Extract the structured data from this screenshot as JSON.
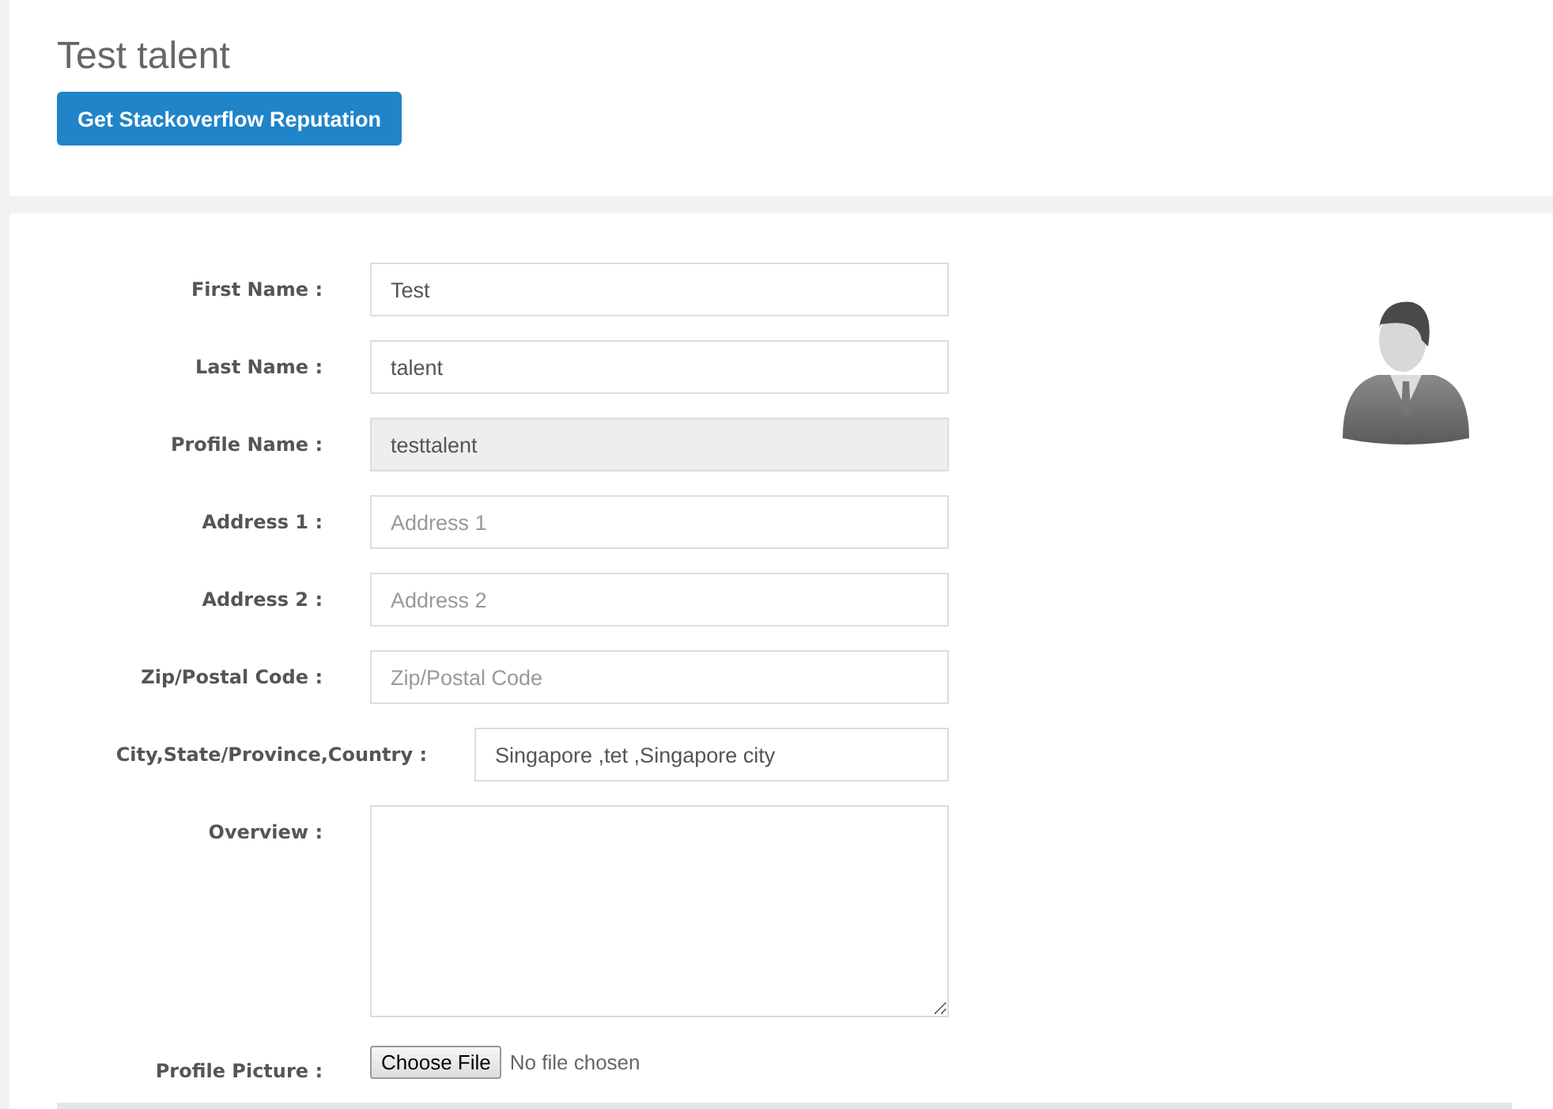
{
  "header": {
    "title": "Test talent",
    "button": "Get Stackoverflow Reputation"
  },
  "form": {
    "fields": [
      {
        "kind": "text",
        "label": "First Name :",
        "value": "Test",
        "disabled": false
      },
      {
        "kind": "text",
        "label": "Last Name :",
        "value": "talent",
        "disabled": false
      },
      {
        "kind": "text",
        "label": "Profile Name :",
        "value": "testtalent",
        "disabled": true
      },
      {
        "kind": "text",
        "label": "Address 1 :",
        "placeholder": "Address 1",
        "disabled": false
      },
      {
        "kind": "text",
        "label": "Address 2 :",
        "placeholder": "Address 2",
        "disabled": false
      },
      {
        "kind": "text",
        "label": "Zip/Postal Code :",
        "placeholder": "Zip/Postal Code",
        "disabled": false
      },
      {
        "kind": "text",
        "label": "City,State/Province,Country :",
        "value": "Singapore ,tet ,Singapore city",
        "disabled": false
      },
      {
        "kind": "textarea",
        "label": "Overview :"
      },
      {
        "kind": "file",
        "label": "Profile Picture :",
        "button": "Choose File",
        "status": "No file chosen"
      }
    ]
  }
}
